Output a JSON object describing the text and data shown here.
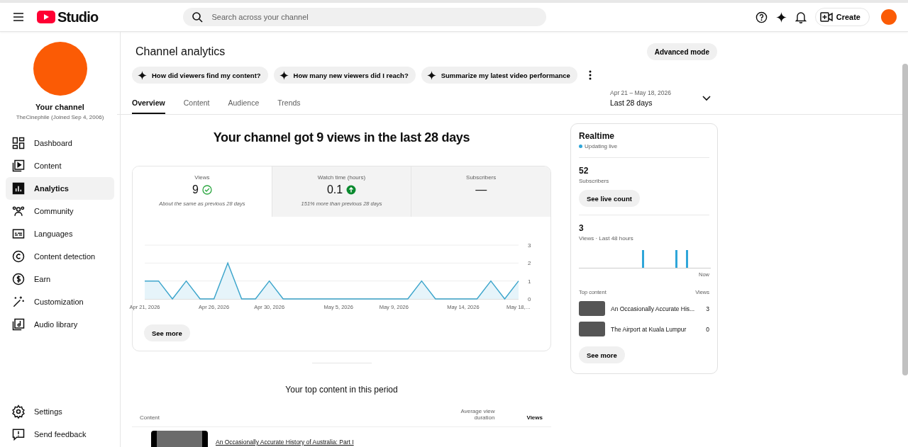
{
  "header": {
    "logo_text": "Studio",
    "search": {
      "placeholder": "Search across your channel"
    },
    "create_label": "Create"
  },
  "sidebar": {
    "channel": {
      "title": "Your channel",
      "subtitle": "TheCinephile (Joined Sep 4, 2006)"
    },
    "items": [
      {
        "label": "Dashboard",
        "selected": false
      },
      {
        "label": "Content",
        "selected": false
      },
      {
        "label": "Analytics",
        "selected": true
      },
      {
        "label": "Community",
        "selected": false
      },
      {
        "label": "Languages",
        "selected": false
      },
      {
        "label": "Content detection",
        "selected": false
      },
      {
        "label": "Earn",
        "selected": false
      },
      {
        "label": "Customization",
        "selected": false
      },
      {
        "label": "Audio library",
        "selected": false
      }
    ],
    "bottom_items": [
      {
        "label": "Settings"
      },
      {
        "label": "Send feedback"
      }
    ]
  },
  "page": {
    "title": "Channel analytics",
    "advanced_button": "Advanced mode",
    "chips": [
      "How did viewers find my content?",
      "How many new viewers did I reach?",
      "Summarize my latest video performance"
    ],
    "tabs": [
      {
        "label": "Overview",
        "selected": true
      },
      {
        "label": "Content",
        "selected": false
      },
      {
        "label": "Audience",
        "selected": false
      },
      {
        "label": "Trends",
        "selected": false
      }
    ],
    "date_range": {
      "range": "Apr 21 – May 18, 2026",
      "label": "Last 28 days"
    }
  },
  "overview": {
    "headline": "Your channel got 9 views in the last 28 days",
    "metrics": [
      {
        "label": "Views",
        "value": "9",
        "kind": "check",
        "note": "About the same as previous 28 days",
        "selected": true
      },
      {
        "label": "Watch time (hours)",
        "value": "0.1",
        "kind": "up",
        "note": "151% more than previous 28 days",
        "selected": false
      },
      {
        "label": "Subscribers",
        "value": "—",
        "kind": "plain",
        "selected": false
      }
    ],
    "chart_data": {
      "type": "area",
      "categories": [
        "Apr 21, 2026",
        null,
        null,
        null,
        null,
        "Apr 26, 2026",
        null,
        null,
        null,
        "Apr 30, 2026",
        null,
        null,
        null,
        null,
        "May 5, 2026",
        null,
        null,
        null,
        "May 9, 2026",
        null,
        null,
        null,
        null,
        "May 14, 2026",
        null,
        null,
        null,
        "May 18,…"
      ],
      "values": [
        1,
        1,
        0,
        1,
        0,
        0,
        2,
        0,
        0,
        1,
        0,
        0,
        0,
        0,
        0,
        0,
        0,
        0,
        0,
        0,
        1,
        0,
        0,
        0,
        0,
        1,
        0,
        1
      ],
      "ylim": [
        0,
        3
      ],
      "yticks": [
        0,
        1,
        2,
        3
      ]
    },
    "see_more": "See more"
  },
  "realtime": {
    "title": "Realtime",
    "status": "Updating live",
    "subscribers_value": "52",
    "subscribers_label": "Subscribers",
    "live_button": "See live count",
    "views_value": "3",
    "views_label": "Views · Last 48 hours",
    "axis_label": "Now",
    "top_header": "Top content",
    "views_header": "Views",
    "rows": [
      {
        "title": "An Occasionally Accurate His...",
        "views": "3"
      },
      {
        "title": "The Airport at Kuala Lumpur",
        "views": "0"
      }
    ],
    "see_more": "See more"
  },
  "top_content": {
    "title": "Your top content in this period",
    "columns": [
      "Content",
      "Average view duration",
      "Views"
    ],
    "rows": [
      {
        "title": "An Occasionally Accurate History of Australia: Part I"
      }
    ]
  }
}
